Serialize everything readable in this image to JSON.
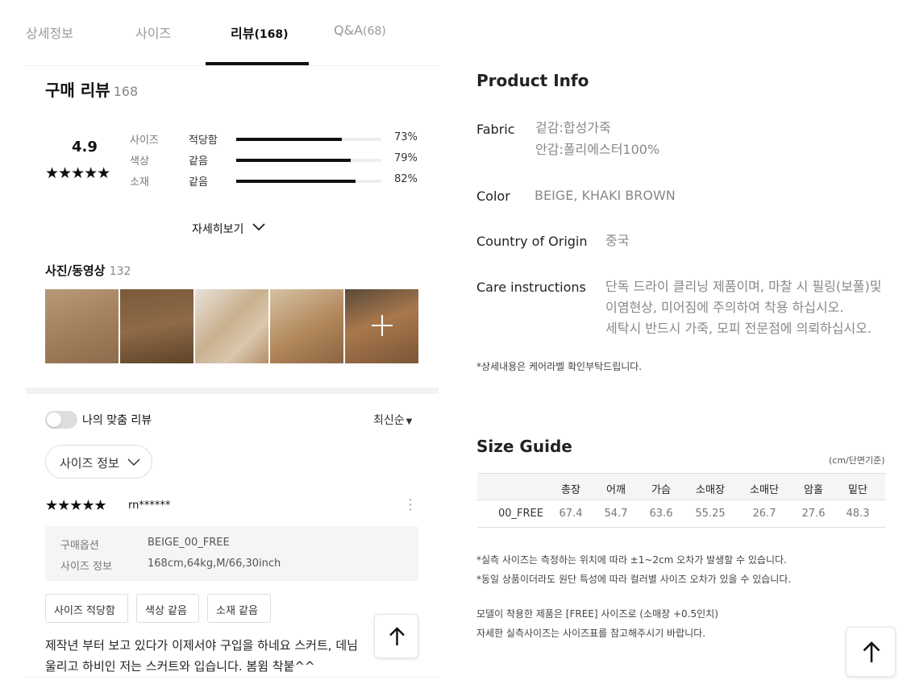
{
  "tabs": [
    {
      "label": "상세정보",
      "count": ""
    },
    {
      "label": "사이즈",
      "count": ""
    },
    {
      "label": "리뷰",
      "count": "(168)"
    },
    {
      "label": "Q&A",
      "count": "(68)"
    }
  ],
  "review_summary": {
    "title": "구매 리뷰",
    "count": "168",
    "score": "4.9",
    "stars": "★★★★★",
    "stats": [
      {
        "label": "사이즈",
        "value": "적당함",
        "percent": "73%",
        "fraction": 0.73
      },
      {
        "label": "색상",
        "value": "같음",
        "percent": "79%",
        "fraction": 0.79
      },
      {
        "label": "소재",
        "value": "같음",
        "percent": "82%",
        "fraction": 0.82
      }
    ],
    "more_label": "자세히보기"
  },
  "photos": {
    "title": "사진/동영상",
    "count": "132"
  },
  "filters": {
    "toggle_label": "나의 맞춤 리뷰",
    "sort_label": "최신순",
    "size_pill": "사이즈 정보"
  },
  "review": {
    "stars": "★★★★★",
    "reviewer": "rn******",
    "options": [
      {
        "key": "구매옵션",
        "value": "BEIGE_00_FREE"
      },
      {
        "key": "사이즈 정보",
        "value": "168cm,64kg,M/66,30inch"
      }
    ],
    "chips": [
      "사이즈 적당함",
      "색상 같음",
      "소재 같음"
    ],
    "text_line1": "제작년 부터 보고 있다가 이제서야 구입을 하네요 스커트, 데님",
    "text_line2": "울리고 하비인 저는 스커트와 입습니다. 봄윔 착붙^^"
  },
  "product_info": {
    "title": "Product Info",
    "fabric_key": "Fabric",
    "fabric_line1": "겉감:합성가죽",
    "fabric_line2": "안감:폴리에스터100%",
    "color_key": "Color",
    "color_value": "BEIGE, KHAKI BROWN",
    "origin_key": "Country of Origin",
    "origin_value": "중국",
    "care_key": "Care instructions",
    "care_line1": "단독 드라이 클리닝 제품이며, 마찰 시 필링(보풀)및",
    "care_line2": "이염현상, 미어짐에 주의하여 착용 하십시오.",
    "care_line3": "세탁시 반드시 가죽, 모피 전문점에 의뢰하십시오.",
    "note": "*상세내용은 케어라벨 확인부탁드립니다."
  },
  "size_guide": {
    "title": "Size Guide",
    "unit": "(cm/단면기준)",
    "headers": [
      "",
      "총장",
      "어깨",
      "가슴",
      "소매장",
      "소매단",
      "암홀",
      "밑단"
    ],
    "row": [
      "00_FREE",
      "67.4",
      "54.7",
      "63.6",
      "55.25",
      "26.7",
      "27.6",
      "48.3"
    ],
    "note1": "*실측 사이즈는 측정하는 위치에 따라 ±1~2cm 오차가 발생할 수 있습니다.",
    "note2": "*동일 상품이더라도 원단 특성에 따라 컬러별 사이즈 오차가 있을 수 있습니다.",
    "model1": "모델이 착용한 제품은 [FREE] 사이즈로 (소매장 +0.5인치)",
    "model2": "자세한 실측사이즈는 사이즈표를 참고해주시기 바랍니다."
  }
}
